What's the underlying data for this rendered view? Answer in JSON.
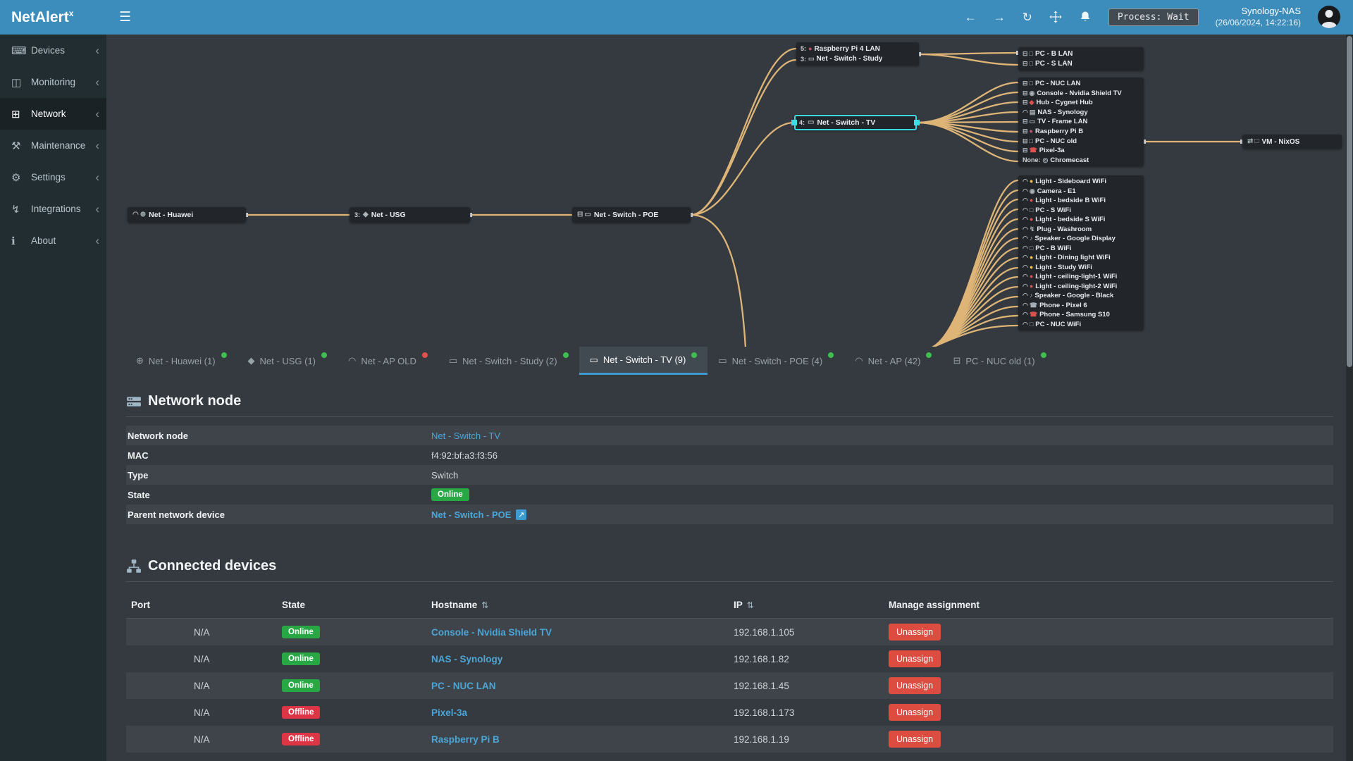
{
  "topbar": {
    "brand": "NetAlert",
    "brand_sup": "x",
    "hamburger": "☰",
    "nav_back": "←",
    "nav_forward": "→",
    "nav_refresh": "↻",
    "process_label": "Process: Wait",
    "host": "Synology-NAS",
    "timestamp": "(26/06/2024, 14:22:16)"
  },
  "colors": {
    "accent": "#3c8dbc",
    "link": "#4ba6d8",
    "online": "#28a745",
    "offline": "#dc3545",
    "line": "#edc07c",
    "selection": "#41dbe4"
  },
  "sidebar": {
    "items": [
      {
        "name": "sidebar-item-devices",
        "icon_name": "laptop-icon",
        "glyph": "⌨",
        "label": "Devices",
        "active": false
      },
      {
        "name": "sidebar-item-monitoring",
        "icon_name": "chart-icon",
        "glyph": "◫",
        "label": "Monitoring",
        "active": false
      },
      {
        "name": "sidebar-item-network",
        "icon_name": "sitemap-icon",
        "glyph": "⊞",
        "label": "Network",
        "active": true
      },
      {
        "name": "sidebar-item-maintenance",
        "icon_name": "wrench-icon",
        "glyph": "⚒",
        "label": "Maintenance",
        "active": false
      },
      {
        "name": "sidebar-item-settings",
        "icon_name": "gear-icon",
        "glyph": "⚙",
        "label": "Settings",
        "active": false
      },
      {
        "name": "sidebar-item-integrations",
        "icon_name": "plug-icon",
        "glyph": "↯",
        "label": "Integrations",
        "active": false
      },
      {
        "name": "sidebar-item-about",
        "icon_name": "info-icon",
        "glyph": "ℹ",
        "label": "About",
        "active": false
      }
    ],
    "chevron": "‹"
  },
  "diagram": {
    "nodes": {
      "huawei": {
        "label": "Net - Huawei",
        "icons": [
          {
            "n": "wifi",
            "g": "◠"
          },
          {
            "n": "globe",
            "g": "⊕"
          }
        ]
      },
      "usg": {
        "port": "3:",
        "label": "Net - USG",
        "icons": [
          {
            "n": "gateway",
            "g": "◆"
          }
        ]
      },
      "poe": {
        "label": "Net - Switch - POE",
        "icons": [
          {
            "n": "ethernet",
            "g": "⊟"
          },
          {
            "n": "switch",
            "g": "▭"
          }
        ]
      },
      "tv": {
        "port": "4:",
        "label": "Net - Switch - TV",
        "icons": [
          {
            "n": "switch",
            "g": "▭"
          }
        ]
      },
      "vm": {
        "label": "VM - NixOS",
        "icons": [
          {
            "n": "link",
            "g": "⇄"
          },
          {
            "n": "pc",
            "g": "□"
          }
        ]
      }
    },
    "study_group": [
      {
        "port": "5:",
        "label": "Raspberry Pi 4 LAN",
        "icons": [
          {
            "n": "raspberry-pi",
            "g": "●",
            "c": "#c2556b"
          }
        ]
      },
      {
        "port": "3:",
        "label": "Net - Switch - Study",
        "icons": [
          {
            "n": "switch",
            "g": "▭"
          }
        ]
      }
    ],
    "pc_group": [
      {
        "label": "PC - B LAN",
        "icons": [
          {
            "n": "ethernet",
            "g": "⊟"
          },
          {
            "n": "pc",
            "g": "□"
          }
        ]
      },
      {
        "label": "PC - S LAN",
        "icons": [
          {
            "n": "ethernet",
            "g": "⊟"
          },
          {
            "n": "pc",
            "g": "□"
          }
        ]
      }
    ],
    "tv_group": [
      {
        "label": "PC - NUC LAN",
        "icons": [
          {
            "n": "ethernet",
            "g": "⊟"
          },
          {
            "n": "pc",
            "g": "□"
          }
        ]
      },
      {
        "label": "Console - Nvidia Shield TV",
        "icons": [
          {
            "n": "ethernet",
            "g": "⊟"
          },
          {
            "n": "gamepad",
            "g": "◉"
          }
        ]
      },
      {
        "label": "Hub - Cygnet Hub",
        "icons": [
          {
            "n": "ethernet",
            "g": "⊟"
          },
          {
            "n": "hub",
            "g": "◆",
            "c": "#e0524e"
          }
        ]
      },
      {
        "label": "NAS - Synology",
        "icons": [
          {
            "n": "wifi",
            "g": "◠"
          },
          {
            "n": "nas",
            "g": "▤"
          }
        ]
      },
      {
        "label": "TV - Frame LAN",
        "icons": [
          {
            "n": "ethernet",
            "g": "⊟"
          },
          {
            "n": "tv",
            "g": "▭"
          }
        ]
      },
      {
        "label": "Raspberry Pi B",
        "icons": [
          {
            "n": "ethernet",
            "g": "⊟"
          },
          {
            "n": "raspberry-pi",
            "g": "●",
            "c": "#c2556b"
          }
        ]
      },
      {
        "label": "PC - NUC old",
        "icons": [
          {
            "n": "ethernet",
            "g": "⊟"
          },
          {
            "n": "pc",
            "g": "□"
          }
        ]
      },
      {
        "label": "Pixel-3a",
        "icons": [
          {
            "n": "ethernet",
            "g": "⊟"
          },
          {
            "n": "phone",
            "g": "☎",
            "c": "#e0524e"
          }
        ]
      },
      {
        "port": "None:",
        "label": "Chromecast",
        "icons": [
          {
            "n": "cast",
            "g": "◎"
          }
        ]
      }
    ],
    "ap_group": [
      {
        "label": "Light - Sideboard WiFi",
        "icons": [
          {
            "n": "wifi",
            "g": "◠"
          },
          {
            "n": "bulb",
            "g": "●",
            "c": "#f3c33f"
          }
        ]
      },
      {
        "label": "Camera - E1",
        "icons": [
          {
            "n": "wifi",
            "g": "◠"
          },
          {
            "n": "camera",
            "g": "◉"
          }
        ]
      },
      {
        "label": "Light - bedside B WiFi",
        "icons": [
          {
            "n": "wifi",
            "g": "◠"
          },
          {
            "n": "bulb",
            "g": "●",
            "c": "#e0524e"
          }
        ]
      },
      {
        "label": "PC - S WiFi",
        "icons": [
          {
            "n": "wifi",
            "g": "◠"
          },
          {
            "n": "pc",
            "g": "□"
          }
        ]
      },
      {
        "label": "Light - bedside S WiFi",
        "icons": [
          {
            "n": "wifi",
            "g": "◠"
          },
          {
            "n": "bulb",
            "g": "●",
            "c": "#e0524e"
          }
        ]
      },
      {
        "label": "Plug - Washroom",
        "icons": [
          {
            "n": "wifi",
            "g": "◠"
          },
          {
            "n": "plug",
            "g": "↯"
          }
        ]
      },
      {
        "label": "Speaker - Google Display",
        "icons": [
          {
            "n": "wifi",
            "g": "◠"
          },
          {
            "n": "speaker",
            "g": "♪"
          }
        ]
      },
      {
        "label": "PC - B WiFi",
        "icons": [
          {
            "n": "wifi",
            "g": "◠"
          },
          {
            "n": "pc",
            "g": "□"
          }
        ]
      },
      {
        "label": "Light - Dining light WiFi",
        "icons": [
          {
            "n": "wifi",
            "g": "◠"
          },
          {
            "n": "bulb",
            "g": "●",
            "c": "#f3c33f"
          }
        ]
      },
      {
        "label": "Light - Study WiFi",
        "icons": [
          {
            "n": "wifi",
            "g": "◠"
          },
          {
            "n": "bulb",
            "g": "●",
            "c": "#f3c33f"
          }
        ]
      },
      {
        "label": "Light - ceiling-light-1 WiFi",
        "icons": [
          {
            "n": "wifi",
            "g": "◠"
          },
          {
            "n": "bulb",
            "g": "●",
            "c": "#e0524e"
          }
        ]
      },
      {
        "label": "Light - ceiling-light-2 WiFi",
        "icons": [
          {
            "n": "wifi",
            "g": "◠"
          },
          {
            "n": "bulb",
            "g": "●",
            "c": "#e0524e"
          }
        ]
      },
      {
        "label": "Speaker - Google - Black",
        "icons": [
          {
            "n": "wifi",
            "g": "◠"
          },
          {
            "n": "speaker",
            "g": "♪"
          }
        ]
      },
      {
        "label": "Phone - Pixel 6",
        "icons": [
          {
            "n": "wifi",
            "g": "◠"
          },
          {
            "n": "phone",
            "g": "☎"
          }
        ]
      },
      {
        "label": "Phone - Samsung S10",
        "icons": [
          {
            "n": "wifi",
            "g": "◠"
          },
          {
            "n": "phone",
            "g": "☎",
            "c": "#e0524e"
          }
        ]
      },
      {
        "label": "PC - NUC WiFi",
        "icons": [
          {
            "n": "wifi",
            "g": "◠"
          },
          {
            "n": "pc",
            "g": "□"
          }
        ]
      }
    ]
  },
  "tabs": [
    {
      "icon_name": "globe-icon",
      "glyph": "⊕",
      "label": "Net - Huawei (1)",
      "dot": "#3fbf4f",
      "active": false
    },
    {
      "icon_name": "gateway-icon",
      "glyph": "◆",
      "label": "Net - USG (1)",
      "dot": "#3fbf4f",
      "active": false
    },
    {
      "icon_name": "wifi-icon",
      "glyph": "◠",
      "label": "Net - AP OLD",
      "dot": "#e0524e",
      "active": false
    },
    {
      "icon_name": "switch-icon",
      "glyph": "▭",
      "label": "Net - Switch - Study (2)",
      "dot": "#3fbf4f",
      "active": false
    },
    {
      "icon_name": "switch-icon",
      "glyph": "▭",
      "label": "Net - Switch - TV (9)",
      "dot": "#3fbf4f",
      "active": true
    },
    {
      "icon_name": "switch-icon",
      "glyph": "▭",
      "label": "Net - Switch - POE (4)",
      "dot": "#3fbf4f",
      "active": false
    },
    {
      "icon_name": "wifi-icon",
      "glyph": "◠",
      "label": "Net - AP (42)",
      "dot": "#3fbf4f",
      "active": false
    },
    {
      "icon_name": "ethernet-icon",
      "glyph": "⊟",
      "label": "PC - NUC old (1)",
      "dot": "#3fbf4f",
      "active": false
    }
  ],
  "node_section": {
    "title": "Network node",
    "rows": [
      {
        "label": "Network node",
        "value": "Net - Switch - TV",
        "kind": "link"
      },
      {
        "label": "MAC",
        "value": "f4:92:bf:a3:f3:56",
        "kind": "text"
      },
      {
        "label": "Type",
        "value": "Switch",
        "kind": "text"
      },
      {
        "label": "State",
        "value": "Online",
        "kind": "badge"
      },
      {
        "label": "Parent network device",
        "value": "Net - Switch - POE",
        "kind": "link-ext"
      }
    ]
  },
  "devices_section": {
    "title": "Connected devices",
    "headers": {
      "port": "Port",
      "state": "State",
      "hostname": "Hostname",
      "ip": "IP",
      "manage": "Manage assignment"
    },
    "sort_glyph": "⇅",
    "rows": [
      {
        "port": "N/A",
        "state": "Online",
        "hostname": "Console - Nvidia Shield TV",
        "ip": "192.168.1.105",
        "action": "Unassign"
      },
      {
        "port": "N/A",
        "state": "Online",
        "hostname": "NAS - Synology",
        "ip": "192.168.1.82",
        "action": "Unassign"
      },
      {
        "port": "N/A",
        "state": "Online",
        "hostname": "PC - NUC LAN",
        "ip": "192.168.1.45",
        "action": "Unassign"
      },
      {
        "port": "N/A",
        "state": "Offline",
        "hostname": "Pixel-3a",
        "ip": "192.168.1.173",
        "action": "Unassign"
      },
      {
        "port": "N/A",
        "state": "Offline",
        "hostname": "Raspberry Pi B",
        "ip": "192.168.1.19",
        "action": "Unassign"
      }
    ]
  }
}
